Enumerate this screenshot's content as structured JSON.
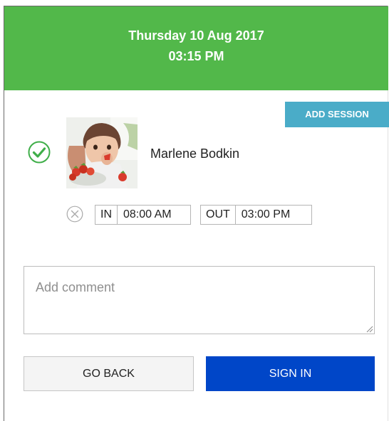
{
  "header": {
    "date": "Thursday 10 Aug 2017",
    "time": "03:15 PM",
    "background_color": "#52b84a"
  },
  "actions": {
    "add_session_label": "ADD SESSION",
    "add_session_color": "#4aacc8"
  },
  "child": {
    "name": "Marlene Bodkin",
    "status_icon": "check-circle-icon",
    "status_color": "#3fae49"
  },
  "session": {
    "remove_icon": "close-circle-icon",
    "in_label": "IN",
    "in_time": "08:00 AM",
    "out_label": "OUT",
    "out_time": "03:00 PM"
  },
  "comment": {
    "value": "",
    "placeholder": "Add comment"
  },
  "footer": {
    "go_back_label": "GO BACK",
    "sign_in_label": "SIGN IN",
    "sign_in_color": "#0046c8"
  }
}
